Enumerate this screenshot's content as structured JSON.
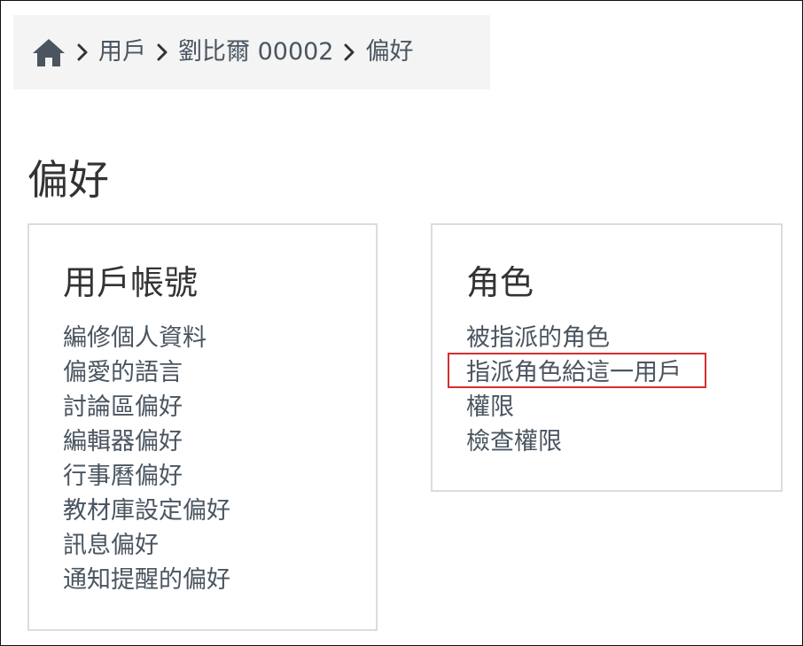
{
  "breadcrumb": {
    "home_icon": "home-icon",
    "separator_icon": "chevron-right-icon",
    "items": [
      {
        "label": "用戶"
      },
      {
        "label": "劉比爾 00002"
      }
    ],
    "current": "偏好"
  },
  "page": {
    "title": "偏好"
  },
  "account_card": {
    "title": "用戶帳號",
    "links": [
      {
        "label": "編修個人資料"
      },
      {
        "label": "偏愛的語言"
      },
      {
        "label": "討論區偏好"
      },
      {
        "label": "編輯器偏好"
      },
      {
        "label": "行事曆偏好"
      },
      {
        "label": "教材庫設定偏好"
      },
      {
        "label": "訊息偏好"
      },
      {
        "label": "通知提醒的偏好"
      }
    ]
  },
  "roles_card": {
    "title": "角色",
    "links": [
      {
        "label": "被指派的角色"
      },
      {
        "label": "指派角色給這一用戶",
        "highlighted": true
      },
      {
        "label": "權限"
      },
      {
        "label": "檢查權限"
      }
    ]
  },
  "colors": {
    "link": "#4a5560",
    "highlight_border": "#d32f2f",
    "breadcrumb_bg": "#f4f4f4",
    "card_border": "#dcdcdc"
  }
}
